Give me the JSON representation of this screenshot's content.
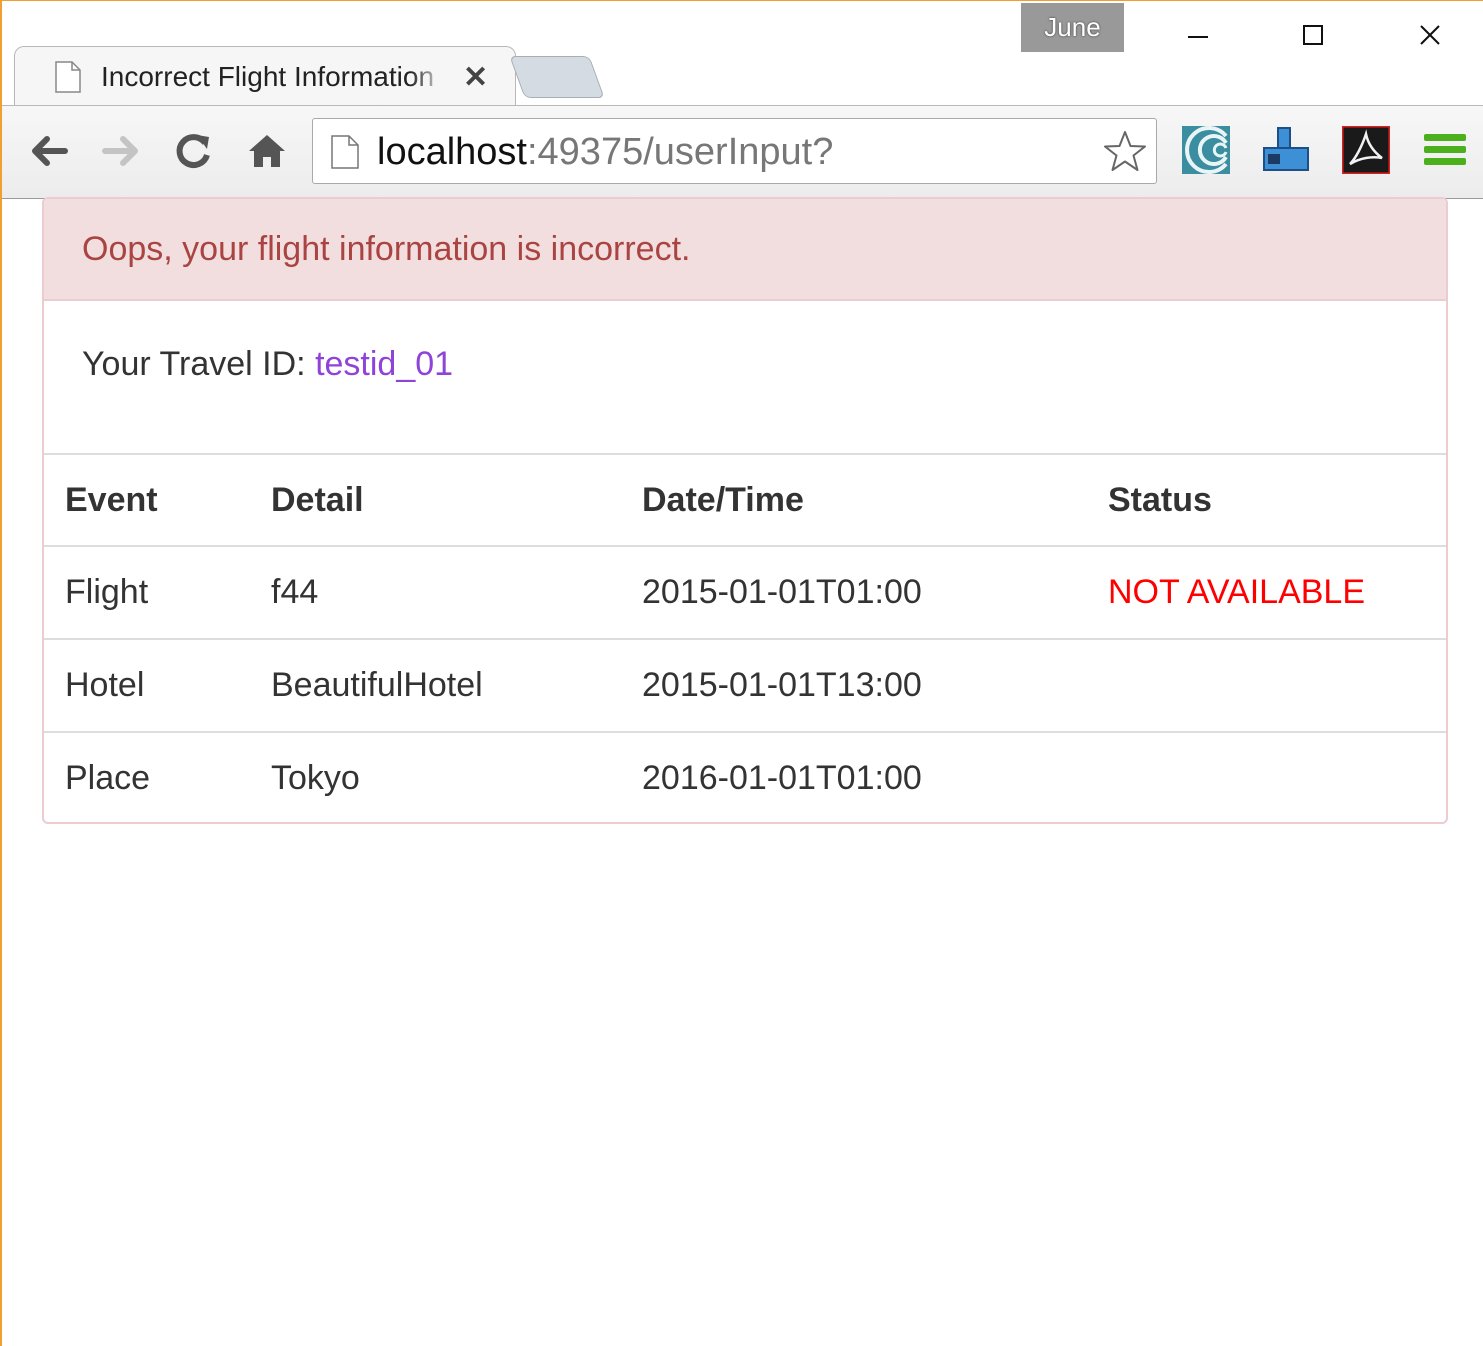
{
  "window": {
    "user_badge": "June",
    "controls": {
      "minimize": "minimize",
      "maximize": "maximize",
      "close": "close"
    }
  },
  "tab": {
    "title": "Incorrect Flight Information",
    "close_glyph": "✕"
  },
  "toolbar": {
    "url_host": "localhost",
    "url_rest": ":49375/userInput?",
    "icons": [
      "back-arrow-icon",
      "forward-arrow-icon",
      "reload-icon",
      "home-icon",
      "page-icon",
      "bookmark-star-icon",
      "extension-icon",
      "extension-icon",
      "pdf-icon",
      "menu-icon"
    ]
  },
  "alert": {
    "heading": "Oops, your flight information is incorrect.",
    "travel_id_label": "Your Travel ID: ",
    "travel_id_value": "testid_01"
  },
  "table": {
    "headers": [
      "Event",
      "Detail",
      "Date/Time",
      "Status"
    ],
    "rows": [
      {
        "event": "Flight",
        "detail": "f44",
        "datetime": "2015-01-01T01:00",
        "status": "NOT AVAILABLE"
      },
      {
        "event": "Hotel",
        "detail": "BeautifulHotel",
        "datetime": "2015-01-01T13:00",
        "status": ""
      },
      {
        "event": "Place",
        "detail": "Tokyo",
        "datetime": "2016-01-01T01:00",
        "status": ""
      }
    ]
  },
  "colors": {
    "alert_bg": "#f2dede",
    "alert_text": "#a94442",
    "alert_border": "#ebccd1",
    "travel_id": "#8e44d9",
    "status_error": "#ff0000",
    "window_accent": "#f0a030"
  }
}
